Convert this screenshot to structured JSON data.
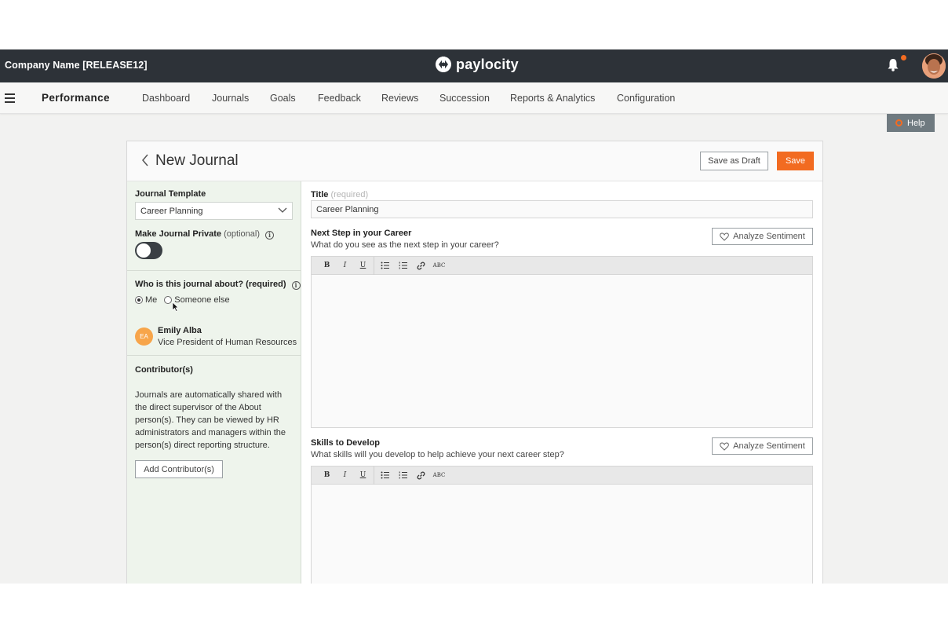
{
  "header": {
    "company": "Company Name [RELEASE12]",
    "logo_text": "paylocity",
    "icons": {
      "bell": "bell-icon",
      "avatar": "user-avatar"
    },
    "accent_color": "#f26b21"
  },
  "nav": {
    "module": "Performance",
    "items": [
      "Dashboard",
      "Journals",
      "Goals",
      "Feedback",
      "Reviews",
      "Succession",
      "Reports & Analytics",
      "Configuration"
    ]
  },
  "help": {
    "label": "Help"
  },
  "page": {
    "title": "New Journal",
    "save_draft": "Save as Draft",
    "save": "Save"
  },
  "left": {
    "template_label": "Journal Template",
    "template_value": "Career Planning",
    "private_label": "Make Journal Private",
    "private_optional": "(optional)",
    "private_on": false,
    "about_label": "Who is this journal about? (required)",
    "radio_me": "Me",
    "radio_someone": "Someone else",
    "person_initials": "EA",
    "person_name": "Emily Alba",
    "person_role": "Vice President of Human Resources",
    "contrib_label": "Contributor(s)",
    "contrib_text": "Journals are automatically shared with the direct supervisor of the About person(s). They can be viewed by HR administrators and managers within the person(s) direct reporting structure.",
    "contrib_button": "Add Contributor(s)"
  },
  "right": {
    "title_label": "Title",
    "title_required": "(required)",
    "title_value": "Career Planning",
    "q1_label": "Next Step in your Career",
    "q1_sub": "What do you see as the next step in your career?",
    "q2_label": "Skills to Develop",
    "q2_sub": "What skills will you develop to help achieve your next career step?",
    "analyze": "Analyze Sentiment",
    "toolbar": {
      "bold": "B",
      "italic": "I",
      "underline": "U",
      "spell": "ABC"
    }
  }
}
